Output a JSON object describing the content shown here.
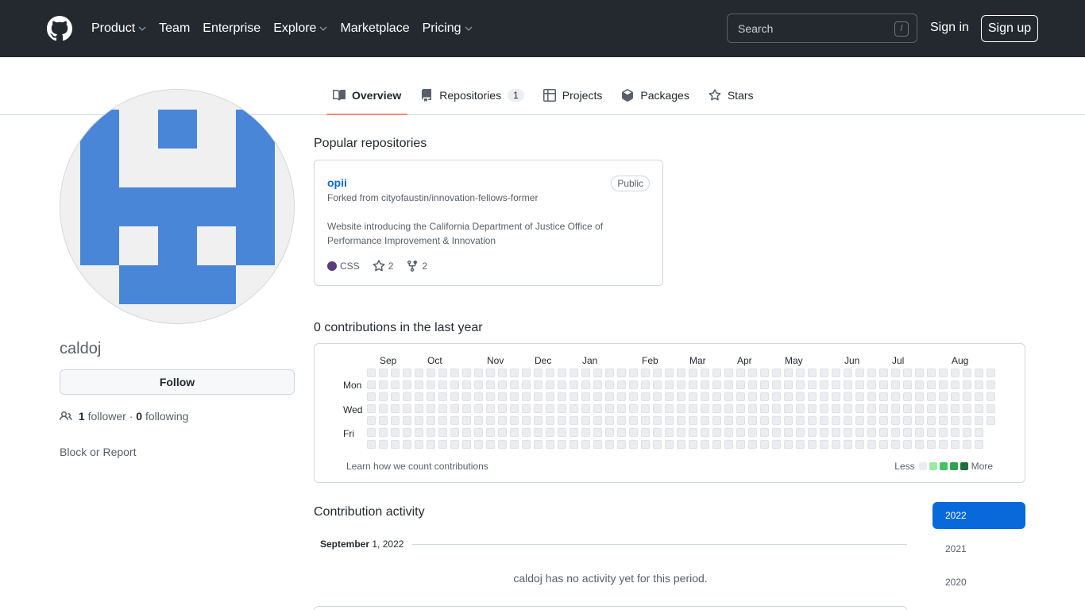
{
  "header": {
    "nav": [
      {
        "label": "Product",
        "dropdown": true
      },
      {
        "label": "Team",
        "dropdown": false
      },
      {
        "label": "Enterprise",
        "dropdown": false
      },
      {
        "label": "Explore",
        "dropdown": true
      },
      {
        "label": "Marketplace",
        "dropdown": false
      },
      {
        "label": "Pricing",
        "dropdown": true
      }
    ],
    "search_placeholder": "Search",
    "search_shortcut": "/",
    "signin_label": "Sign in",
    "signup_label": "Sign up"
  },
  "tabs": [
    {
      "label": "Overview",
      "icon": "book-icon",
      "active": true
    },
    {
      "label": "Repositories",
      "icon": "repo-icon",
      "count": "1"
    },
    {
      "label": "Projects",
      "icon": "table-icon"
    },
    {
      "label": "Packages",
      "icon": "package-icon"
    },
    {
      "label": "Stars",
      "icon": "star-icon"
    }
  ],
  "profile": {
    "username": "caldoj",
    "follow_label": "Follow",
    "followers_count": "1",
    "followers_label": "follower",
    "following_count": "0",
    "following_label": "following",
    "separator": "·",
    "block_label": "Block or Report",
    "avatar_color": "#4a86d8"
  },
  "popular": {
    "title": "Popular repositories",
    "repos": [
      {
        "name": "opii",
        "badge": "Public",
        "fork_prefix": "Forked from",
        "fork_source": "cityofaustin/innovation-fellows-former",
        "description": "Website introducing the California Department of Justice Office of Performance Improvement & Innovation",
        "language": "CSS",
        "language_color": "#563d7c",
        "stars": "2",
        "forks": "2"
      }
    ]
  },
  "contributions": {
    "title": "0 contributions in the last year",
    "months": [
      "Sep",
      "Oct",
      "Nov",
      "Dec",
      "Jan",
      "Feb",
      "Mar",
      "Apr",
      "May",
      "Jun",
      "Jul",
      "Aug"
    ],
    "days": [
      "Mon",
      "Wed",
      "Fri"
    ],
    "learn_label": "Learn how we count contributions",
    "legend_less": "Less",
    "legend_more": "More",
    "legend_colors": [
      "#ebedf0",
      "#9be9a8",
      "#40c463",
      "#30a14e",
      "#216e39"
    ]
  },
  "activity": {
    "title": "Contribution activity",
    "period_month": "September",
    "period_day_year": "1, 2022",
    "empty_message": "caldoj has no activity yet for this period.",
    "years": [
      {
        "label": "2022",
        "active": true
      },
      {
        "label": "2021",
        "active": false
      },
      {
        "label": "2020",
        "active": false
      }
    ]
  }
}
